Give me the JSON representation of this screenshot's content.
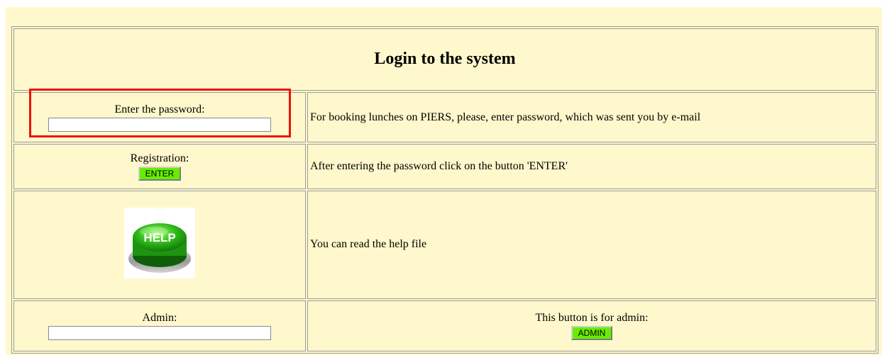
{
  "page": {
    "title": "Login to the system"
  },
  "password_row": {
    "label": "Enter the password:",
    "value": "",
    "description": "For booking lunches on PIERS, please, enter password, which was sent you by e-mail"
  },
  "registration_row": {
    "label": "Registration:",
    "button_label": "ENTER",
    "description": "After entering the password click on the button 'ENTER'"
  },
  "help_row": {
    "image_text": "HELP",
    "description": "You can read the help file"
  },
  "admin_row": {
    "label": "Admin:",
    "value": "",
    "description": "This button is for admin:",
    "button_label": "ADMIN"
  },
  "colors": {
    "background": "#fff8cc",
    "button": "#66ee00",
    "highlight": "#ee1111"
  }
}
